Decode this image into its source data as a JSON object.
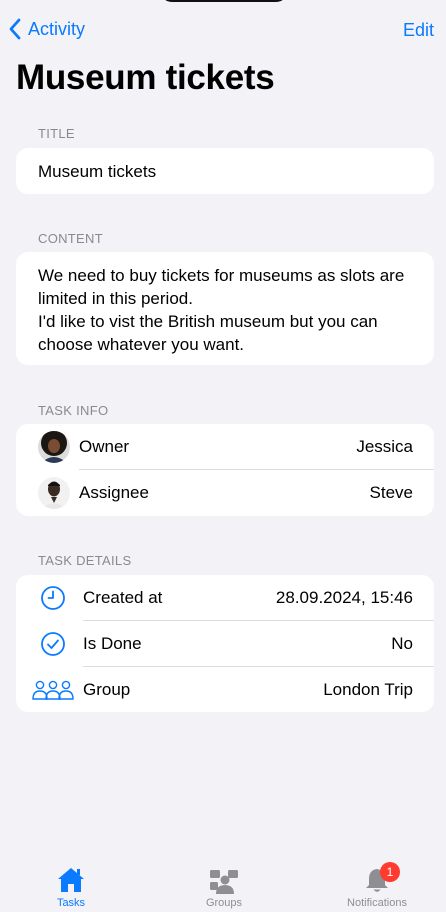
{
  "nav": {
    "back_label": "Activity",
    "edit_label": "Edit"
  },
  "page": {
    "title": "Museum tickets"
  },
  "sections": {
    "title": {
      "header": "TITLE",
      "value": "Museum tickets"
    },
    "content": {
      "header": "CONTENT",
      "paragraph1": "We need to buy tickets for museums as slots are limited in this period.",
      "paragraph2": "I'd like to vist the British museum but you can choose whatever you want."
    },
    "task_info": {
      "header": "TASK INFO",
      "rows": [
        {
          "label": "Owner",
          "value": "Jessica",
          "icon": "avatar-jessica"
        },
        {
          "label": "Assignee",
          "value": "Steve",
          "icon": "avatar-steve"
        }
      ]
    },
    "task_details": {
      "header": "TASK DETAILS",
      "rows": [
        {
          "label": "Created at",
          "value": "28.09.2024, 15:46",
          "icon": "clock-icon"
        },
        {
          "label": "Is Done",
          "value": "No",
          "icon": "checkmark-circle-icon"
        },
        {
          "label": "Group",
          "value": "London Trip",
          "icon": "people-icon"
        }
      ]
    }
  },
  "tabbar": {
    "tabs": [
      {
        "label": "Tasks",
        "icon": "house-icon",
        "active": true
      },
      {
        "label": "Groups",
        "icon": "groups-icon",
        "active": false
      },
      {
        "label": "Notifications",
        "icon": "bell-icon",
        "active": false,
        "badge": "1"
      }
    ]
  },
  "colors": {
    "accent": "#0a7aff",
    "background": "#f2f2f7",
    "badge": "#ff3b30",
    "inactive_tab": "#8e8e93"
  }
}
